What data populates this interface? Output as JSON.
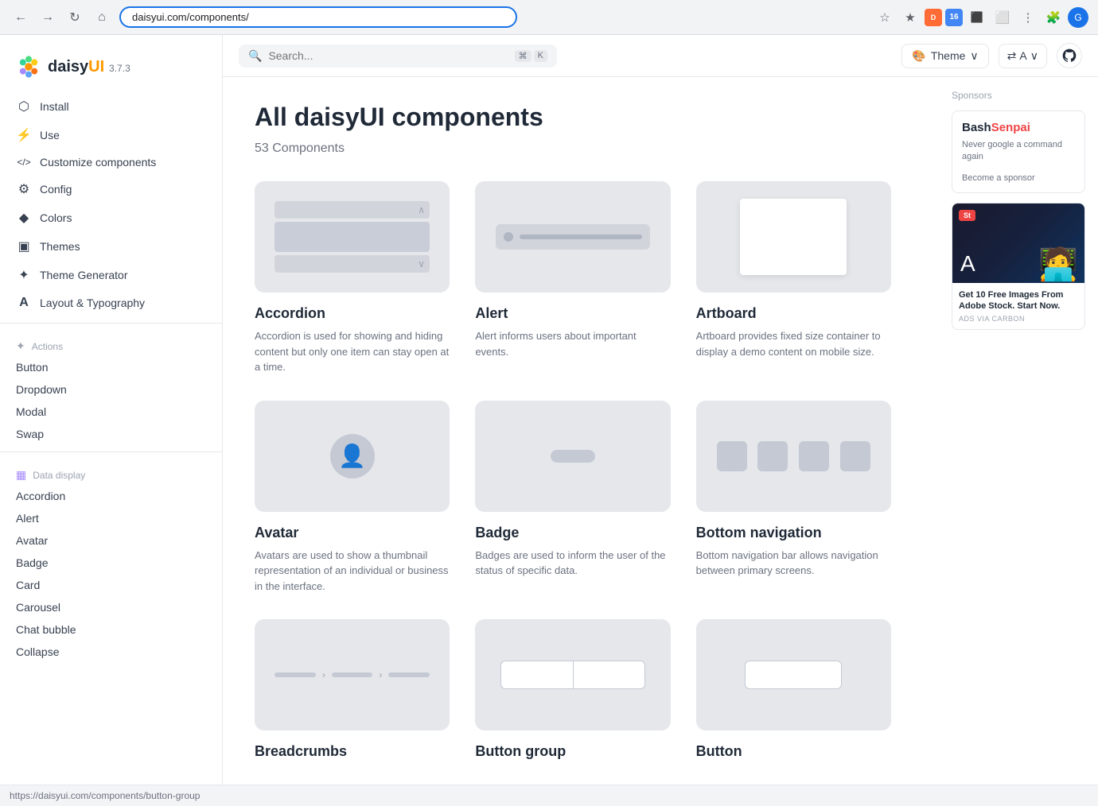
{
  "browser": {
    "url": "daisyui.com/components/",
    "status_url": "https://daisyui.com/components/button-group"
  },
  "header": {
    "logo_text": "daisyUI",
    "logo_version": "3.7.3",
    "search_placeholder": "Search...",
    "search_kbd1": "⌘",
    "search_kbd2": "K",
    "theme_label": "Theme",
    "lang_label": "A",
    "lang_arrow": "∨"
  },
  "sidebar": {
    "nav_items": [
      {
        "label": "Install",
        "icon": "⬡"
      },
      {
        "label": "Use",
        "icon": "⚡"
      },
      {
        "label": "Customize components",
        "icon": "</>"
      },
      {
        "label": "Config",
        "icon": "⚙"
      },
      {
        "label": "Colors",
        "icon": "◆"
      },
      {
        "label": "Themes",
        "icon": "▣"
      },
      {
        "label": "Theme Generator",
        "icon": "✦"
      },
      {
        "label": "Layout & Typography",
        "icon": "A"
      }
    ],
    "sections": [
      {
        "label": "Actions",
        "icon": "✦",
        "items": [
          "Button",
          "Dropdown",
          "Modal",
          "Swap"
        ]
      },
      {
        "label": "Data display",
        "icon": "▦",
        "items": [
          "Accordion",
          "Alert",
          "Avatar",
          "Badge",
          "Card",
          "Carousel",
          "Chat bubble",
          "Collapse"
        ]
      }
    ]
  },
  "main": {
    "page_title": "All daisyUI components",
    "component_count": "53 Components",
    "components": [
      {
        "name": "Accordion",
        "desc": "Accordion is used for showing and hiding content but only one item can stay open at a time.",
        "preview": "accordion"
      },
      {
        "name": "Alert",
        "desc": "Alert informs users about important events.",
        "preview": "alert"
      },
      {
        "name": "Artboard",
        "desc": "Artboard provides fixed size container to display a demo content on mobile size.",
        "preview": "artboard"
      },
      {
        "name": "Avatar",
        "desc": "Avatars are used to show a thumbnail representation of an individual or business in the interface.",
        "preview": "avatar"
      },
      {
        "name": "Badge",
        "desc": "Badges are used to inform the user of the status of specific data.",
        "preview": "badge"
      },
      {
        "name": "Bottom navigation",
        "desc": "Bottom navigation bar allows navigation between primary screens.",
        "preview": "bottom-nav"
      },
      {
        "name": "Breadcrumbs",
        "desc": "",
        "preview": "breadcrumbs"
      },
      {
        "name": "Button group",
        "desc": "",
        "preview": "button-group"
      },
      {
        "name": "Button",
        "desc": "",
        "preview": "button"
      }
    ]
  },
  "sponsors": {
    "label": "Sponsors",
    "bash_senpai": {
      "name_bash": "Bash",
      "name_senpai": "Senpai",
      "desc": "Never google a command again",
      "link": "Become a sponsor"
    },
    "adobe": {
      "text": "Get 10 Free Images From Adobe Stock. Start Now.",
      "tag": "ADS VIA CARBON"
    }
  },
  "status_bar": {
    "url": "https://daisyui.com/components/button-group"
  }
}
